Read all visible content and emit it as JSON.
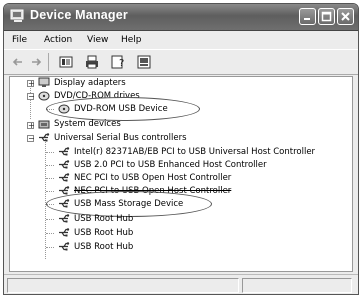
{
  "window": {
    "title": "Device Manager"
  },
  "menu": {
    "file": "File",
    "action": "Action",
    "view": "View",
    "help": "Help"
  },
  "tree": {
    "display_adapters": "Display adapters",
    "dvd_drives": "DVD/CD-ROM drives",
    "dvd_device": "DVD-ROM USB Device",
    "system_devices": "System devices",
    "usb_controllers": "Universal Serial Bus controllers",
    "usb_items": [
      "Intel(r) 82371AB/EB PCI to USB Universal Host Controller",
      "USB 2.0 PCI to USB Enhanced Host Controller",
      "NEC PCI to USB Open Host Controller",
      "NEC PCI to USB Open Host Controller",
      "USB Mass Storage Device",
      "USB Root Hub",
      "USB Root Hub",
      "USB Root Hub"
    ]
  }
}
